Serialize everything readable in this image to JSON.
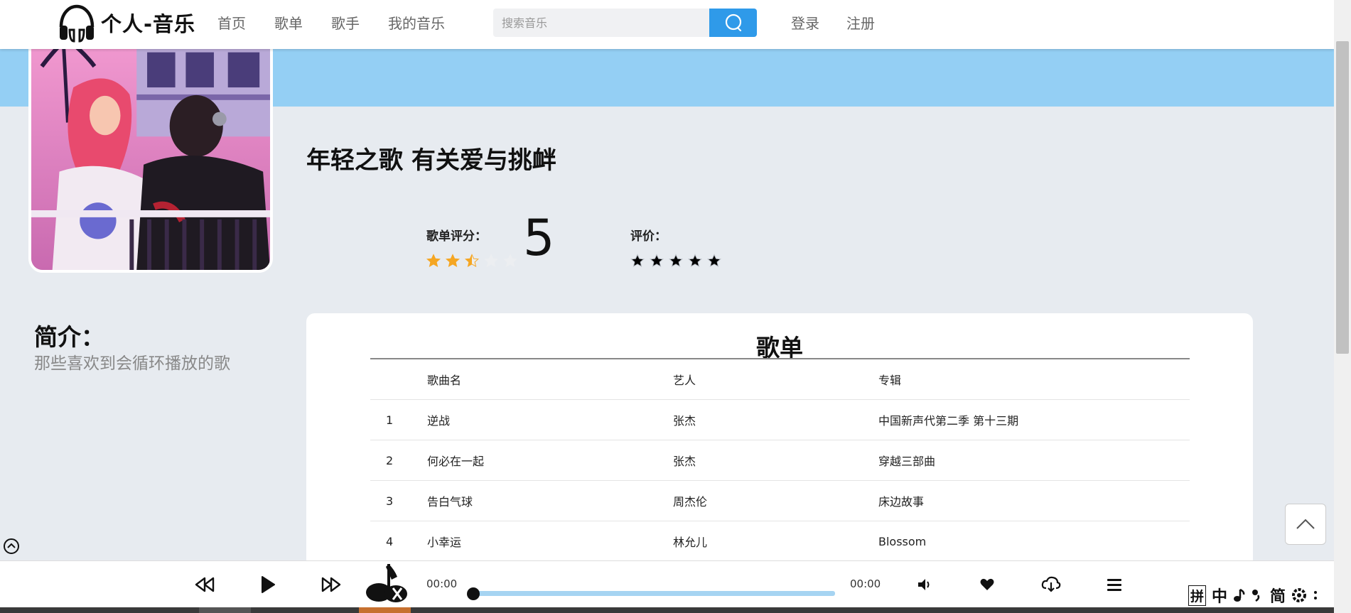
{
  "header": {
    "logo_text": "个人-音乐",
    "nav": [
      "首页",
      "歌单",
      "歌手",
      "我的音乐"
    ],
    "search_placeholder": "搜索音乐",
    "auth": [
      "登录",
      "注册"
    ]
  },
  "playlist": {
    "title": "年轻之歌 有关爱与挑衅",
    "rating_label": "歌单评分：",
    "rating_stars": 2.5,
    "score": "5",
    "comment_label": "评价：",
    "comment_stars": 0
  },
  "intro": {
    "title": "简介：",
    "text": "那些喜欢到会循环播放的歌"
  },
  "songlist": {
    "heading": "歌单",
    "columns": [
      "",
      "歌曲名",
      "艺人",
      "专辑"
    ],
    "rows": [
      [
        "1",
        "逆战",
        "张杰",
        "中国新声代第二季 第十三期"
      ],
      [
        "2",
        "何必在一起",
        "张杰",
        "穿越三部曲"
      ],
      [
        "3",
        "告白气球",
        "周杰伦",
        "床边故事"
      ],
      [
        "4",
        "小幸运",
        "林允儿",
        "Blossom"
      ]
    ]
  },
  "player": {
    "current_time": "00:00",
    "total_time": "00:00",
    "progress": 0
  },
  "ime": {
    "items": [
      "拼",
      "中",
      "简"
    ]
  },
  "colors": {
    "accent": "#2f9ae9",
    "banner": "#94cff4",
    "star": "#f5a623",
    "background": "#e7ebf0"
  }
}
